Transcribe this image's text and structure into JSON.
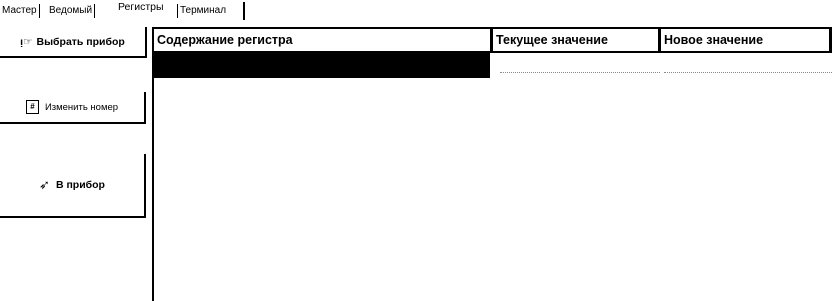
{
  "tabs": [
    {
      "label": "Мастер"
    },
    {
      "label": "Ведомый"
    },
    {
      "label": "Регистры",
      "active": true
    },
    {
      "label": "Терминал"
    }
  ],
  "sidebar": {
    "select_device": {
      "label": "Выбрать прибор",
      "icon": "device-select-icon",
      "glyph": "ᴉ☞"
    },
    "change_number": {
      "label": "Изменить номер",
      "icon": "number-edit-icon",
      "glyph": "#"
    },
    "to_device": {
      "label": "В прибор",
      "icon": "write-to-device-icon",
      "glyph": "➶"
    }
  },
  "grid": {
    "columns": [
      "Содержание регистра",
      "Текущее значение",
      "Новое значение"
    ],
    "rows": [
      {
        "selected": true,
        "content": "",
        "current": "",
        "new": ""
      }
    ]
  }
}
